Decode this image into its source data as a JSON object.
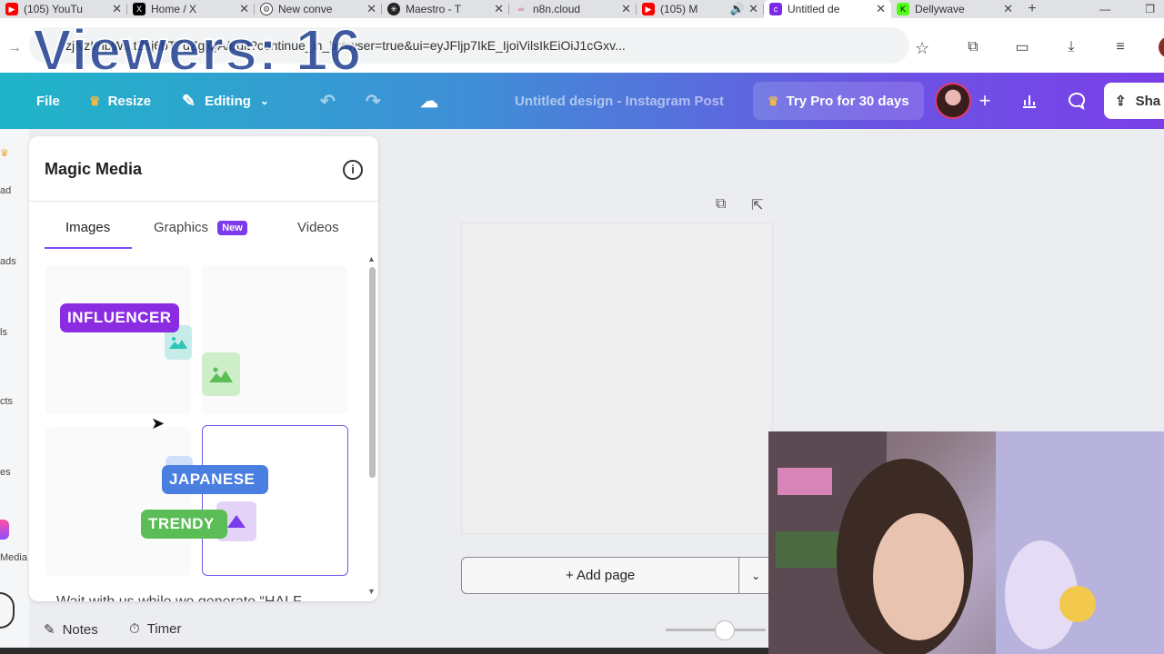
{
  "browser": {
    "tabs": [
      {
        "label": "(105) YouTu",
        "icon": "youtube-icon",
        "color": "#ff0000"
      },
      {
        "label": "Home / X",
        "icon": "x-logo-icon",
        "color": "#000000"
      },
      {
        "label": "New conve",
        "icon": "chatgpt-icon",
        "color": "#444444"
      },
      {
        "label": "Maestro - T",
        "icon": "maestro-icon",
        "color": "#222222"
      },
      {
        "label": "n8n.cloud",
        "icon": "n8n-icon",
        "color": "#ea4b71"
      },
      {
        "label": "(105) M",
        "icon": "youtube-icon",
        "color": "#ff0000"
      },
      {
        "label": "Untitled de",
        "icon": "canva-icon",
        "color": "#7d2ae8"
      },
      {
        "label": "Dellywave",
        "icon": "kick-icon",
        "color": "#53fc18"
      }
    ],
    "active_tab": 6,
    "url": "zjNzI/npW...tZsj6bT7gZgjQA/edit?continue_in_browser=true&ui=eyJFljp7IkE_IjoiVilsIkEiOiJ1cGxv..."
  },
  "overlay": {
    "viewers": "Viewers: 16"
  },
  "topbar": {
    "file": "File",
    "resize": "Resize",
    "editing": "Editing",
    "doc_title": "Untitled design - Instagram Post",
    "try_pro": "Try Pro for 30 days",
    "share": "Sha"
  },
  "rail": {
    "labels": [
      "ad",
      "ads",
      "ls",
      "cts",
      "es",
      "Media"
    ]
  },
  "panel": {
    "title": "Magic Media",
    "tabs": [
      {
        "label": "Images"
      },
      {
        "label": "Graphics"
      },
      {
        "label": "Videos"
      }
    ],
    "new_badge": "New",
    "pills": {
      "influencer": "INFLUENCER",
      "japanese": "JAPANESE",
      "trendy": "TRENDY"
    },
    "wait_text": "Wait with us while we generate “HALF"
  },
  "canvas": {
    "add_page": "+ Add page"
  },
  "bottom": {
    "notes": "Notes",
    "timer": "Timer"
  },
  "colors": {
    "brand_purple": "#7d2ae8",
    "influencer_pill": "#8b2be2",
    "japanese_pill": "#4a7ee0",
    "trendy_pill": "#5bbd56"
  }
}
